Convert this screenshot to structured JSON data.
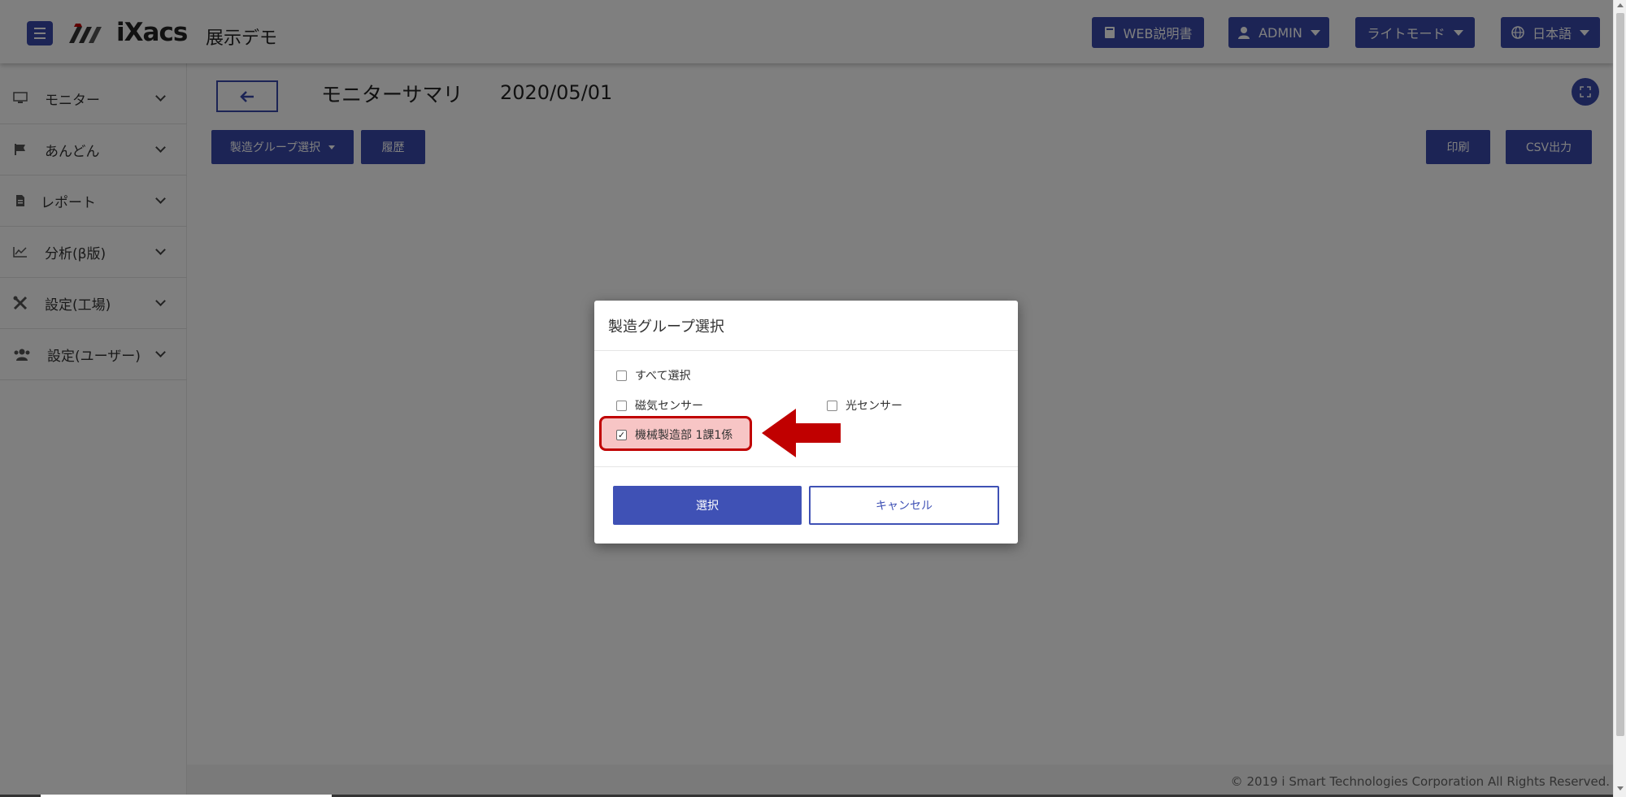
{
  "header": {
    "app_name": "展示デモ",
    "logo_text": "iXacs",
    "buttons": {
      "manual": "WEB説明書",
      "user": "ADMIN",
      "theme": "ライトモード",
      "language": "日本語"
    }
  },
  "sidebar": {
    "items": [
      {
        "label": "モニター",
        "icon": "monitor-icon"
      },
      {
        "label": "あんどん",
        "icon": "flag-icon"
      },
      {
        "label": "レポート",
        "icon": "document-icon"
      },
      {
        "label": "分析(β版)",
        "icon": "chart-line-icon"
      },
      {
        "label": "設定(工場)",
        "icon": "tools-icon"
      },
      {
        "label": "設定(ユーザー)",
        "icon": "users-icon"
      }
    ]
  },
  "main": {
    "title": "モニターサマリ",
    "date": "2020/05/01",
    "toolbar": {
      "group_select": "製造グループ選択",
      "history": "履歴",
      "print": "印刷",
      "csv": "CSV出力"
    }
  },
  "modal": {
    "title": "製造グループ選択",
    "select_all": {
      "label": "すべて選択",
      "checked": false
    },
    "groups": [
      {
        "label": "磁気センサー",
        "checked": false
      },
      {
        "label": "光センサー",
        "checked": false
      },
      {
        "label": "機械製造部 1課1係",
        "checked": true
      }
    ],
    "confirm": "選択",
    "cancel": "キャンセル"
  },
  "footer": {
    "copyright": "© 2019 i Smart Technologies Corporation All Rights Reserved."
  },
  "colors": {
    "primary": "#3949ab",
    "highlight_border": "#c00000",
    "highlight_fill": "#f09696",
    "arrow": "#c00000",
    "overlay": "rgba(0,0,0,0.5)"
  }
}
